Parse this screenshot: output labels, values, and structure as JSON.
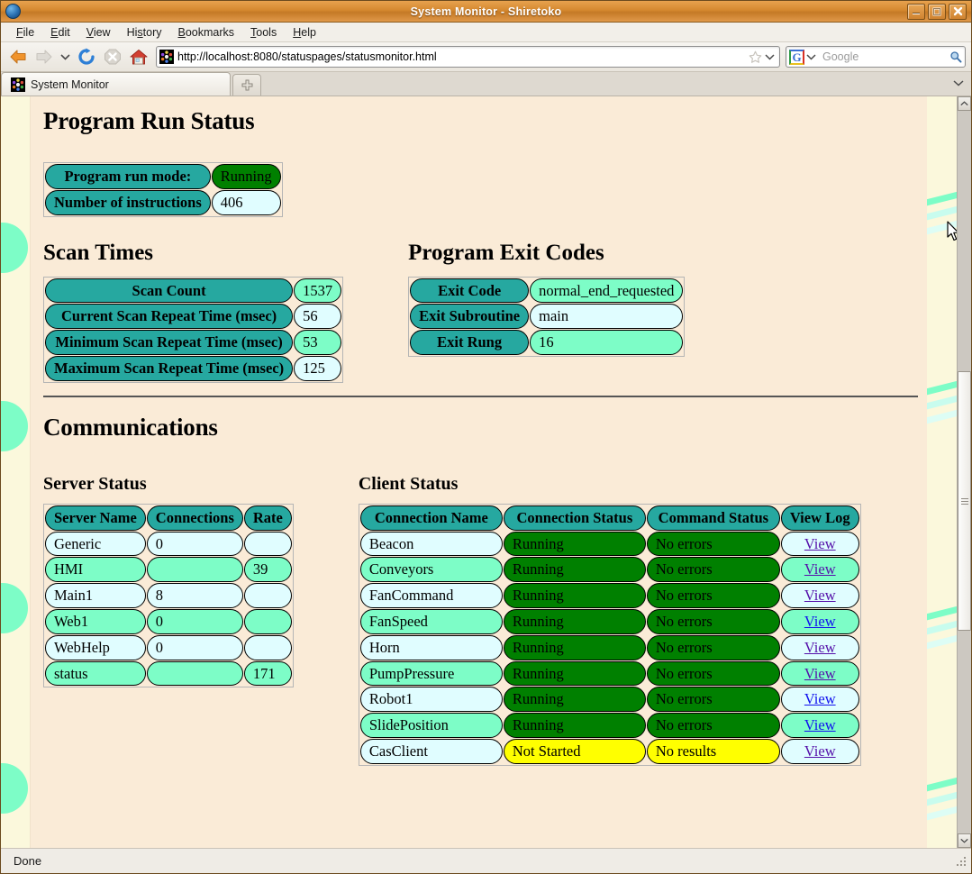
{
  "window": {
    "title": "System Monitor - Shiretoko",
    "minimize_label": "Minimize",
    "maximize_label": "Maximize",
    "close_label": "Close"
  },
  "menubar": {
    "items": [
      {
        "label": "File",
        "accel": "F"
      },
      {
        "label": "Edit",
        "accel": "E"
      },
      {
        "label": "View",
        "accel": "V"
      },
      {
        "label": "History",
        "accel": "s"
      },
      {
        "label": "Bookmarks",
        "accel": "B"
      },
      {
        "label": "Tools",
        "accel": "T"
      },
      {
        "label": "Help",
        "accel": "H"
      }
    ]
  },
  "toolbar": {
    "back_icon": "back-arrow-icon",
    "forward_icon": "forward-arrow-icon",
    "history_dropdown_icon": "chevron-down-icon",
    "reload_icon": "reload-icon",
    "stop_icon": "stop-icon",
    "home_icon": "home-icon",
    "url": "http://localhost:8080/statuspages/statusmonitor.html",
    "bookmark_icon": "star-icon",
    "url_dropdown_icon": "chevron-down-icon",
    "search_engine": "G",
    "search_engine_dropdown_icon": "chevron-down-icon",
    "search_placeholder": "Google",
    "search_go_icon": "magnifier-icon"
  },
  "tabs": {
    "items": [
      {
        "label": "System Monitor",
        "favicon": "site-favicon"
      }
    ],
    "new_tab_icon": "plus-icon",
    "tab_list_icon": "chevron-down-icon"
  },
  "page": {
    "program_run_status": {
      "heading": "Program Run Status",
      "rows": [
        {
          "label": "Program run mode:",
          "value": "Running",
          "value_style": "green"
        },
        {
          "label": "Number of instructions",
          "value": "406",
          "value_style": "light"
        }
      ]
    },
    "scan_times": {
      "heading": "Scan Times",
      "rows": [
        {
          "label": "Scan Count",
          "value": "1537",
          "value_style": "aqua"
        },
        {
          "label": "Current Scan Repeat Time (msec)",
          "value": "56",
          "value_style": "light"
        },
        {
          "label": "Minimum Scan Repeat Time (msec)",
          "value": "53",
          "value_style": "aqua"
        },
        {
          "label": "Maximum Scan Repeat Time (msec)",
          "value": "125",
          "value_style": "light"
        }
      ]
    },
    "program_exit_codes": {
      "heading": "Program Exit Codes",
      "rows": [
        {
          "label": "Exit Code",
          "value": "normal_end_requested",
          "value_style": "aqua"
        },
        {
          "label": "Exit Subroutine",
          "value": "main",
          "value_style": "light"
        },
        {
          "label": "Exit Rung",
          "value": "16",
          "value_style": "aqua"
        }
      ]
    },
    "communications": {
      "heading": "Communications",
      "server_status": {
        "heading": "Server Status",
        "columns": [
          "Server Name",
          "Connections",
          "Rate"
        ],
        "rows": [
          {
            "name": "Generic",
            "connections": "0",
            "rate": "",
            "style": "light"
          },
          {
            "name": "HMI",
            "connections": "",
            "rate": "39",
            "style": "aqua"
          },
          {
            "name": "Main1",
            "connections": "8",
            "rate": "",
            "style": "light"
          },
          {
            "name": "Web1",
            "connections": "0",
            "rate": "",
            "style": "aqua"
          },
          {
            "name": "WebHelp",
            "connections": "0",
            "rate": "",
            "style": "light"
          },
          {
            "name": "status",
            "connections": "",
            "rate": "171",
            "style": "aqua"
          }
        ]
      },
      "client_status": {
        "heading": "Client Status",
        "columns": [
          "Connection Name",
          "Connection Status",
          "Command Status",
          "View Log"
        ],
        "view_label": "View",
        "rows": [
          {
            "name": "Beacon",
            "connection": "Running",
            "command": "No errors",
            "status_style": "green",
            "style": "light",
            "link_visited": true
          },
          {
            "name": "Conveyors",
            "connection": "Running",
            "command": "No errors",
            "status_style": "green",
            "style": "aqua",
            "link_visited": true
          },
          {
            "name": "FanCommand",
            "connection": "Running",
            "command": "No errors",
            "status_style": "green",
            "style": "light",
            "link_visited": true
          },
          {
            "name": "FanSpeed",
            "connection": "Running",
            "command": "No errors",
            "status_style": "green",
            "style": "aqua",
            "link_visited": false
          },
          {
            "name": "Horn",
            "connection": "Running",
            "command": "No errors",
            "status_style": "green",
            "style": "light",
            "link_visited": true
          },
          {
            "name": "PumpPressure",
            "connection": "Running",
            "command": "No errors",
            "status_style": "green",
            "style": "aqua",
            "link_visited": true
          },
          {
            "name": "Robot1",
            "connection": "Running",
            "command": "No errors",
            "status_style": "green",
            "style": "light",
            "link_visited": false
          },
          {
            "name": "SlidePosition",
            "connection": "Running",
            "command": "No errors",
            "status_style": "green",
            "style": "aqua",
            "link_visited": false
          },
          {
            "name": "CasClient",
            "connection": "Not Started",
            "command": "No results",
            "status_style": "yellow",
            "style": "light",
            "link_visited": true
          }
        ]
      }
    }
  },
  "statusbar": {
    "text": "Done"
  },
  "colors": {
    "page_background": "#faebd7",
    "label_teal": "#26a8a0",
    "value_aqua": "#7dfdc7",
    "value_light": "#e0fdff",
    "status_green": "#008000",
    "status_yellow": "#ffff00",
    "link": "#1111ee",
    "link_visited": "#5511aa",
    "titlebar": "#d4882f"
  }
}
